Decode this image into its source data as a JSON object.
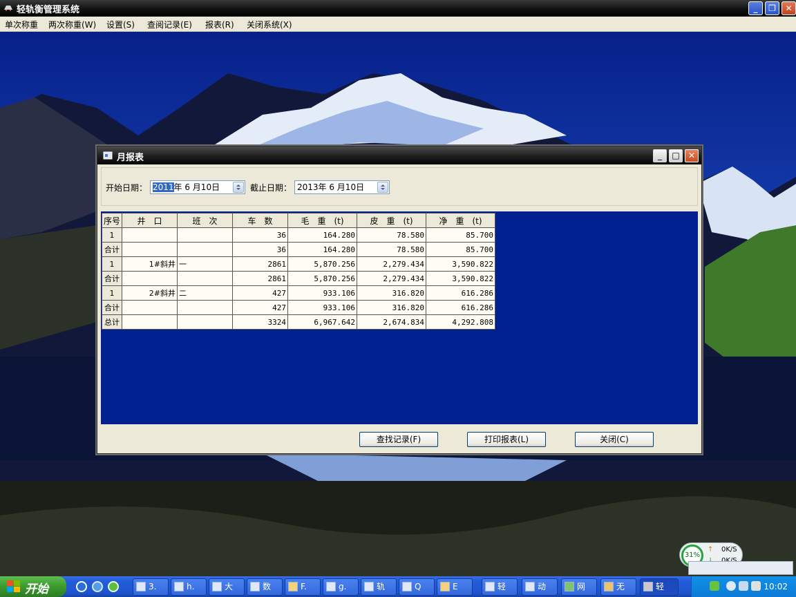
{
  "window": {
    "title": "轻轨衡管理系统",
    "minimize_glyph": "_",
    "restore_glyph": "❐",
    "close_glyph": "✕"
  },
  "menu": {
    "items": [
      {
        "label": "单次称重"
      },
      {
        "label": "两次称重(W)"
      },
      {
        "label": "设置(S)"
      },
      {
        "label": "查阅记录(E)"
      },
      {
        "label": "报表(R)"
      },
      {
        "label": "关闭系统(X)"
      }
    ]
  },
  "dialog": {
    "title": "月报表",
    "start_date_label": "开始日期：",
    "start_date_year": "2011",
    "start_date_rest": "年 6 月10日",
    "end_date_label": "截止日期：",
    "end_date_value": "2013年 6 月10日",
    "columns": [
      "序号",
      "井　口",
      "班　次",
      "车　数",
      "毛　重　(t)",
      "皮　重　(t)",
      "净　重　(t)"
    ],
    "rows": [
      [
        "1",
        "",
        "",
        "36",
        "164.280",
        "78.580",
        "85.700"
      ],
      [
        "合计",
        "",
        "",
        "36",
        "164.280",
        "78.580",
        "85.700"
      ],
      [
        "1",
        "1#斜井",
        "一",
        "2861",
        "5,870.256",
        "2,279.434",
        "3,590.822"
      ],
      [
        "合计",
        "",
        "",
        "2861",
        "5,870.256",
        "2,279.434",
        "3,590.822"
      ],
      [
        "1",
        "2#斜井",
        "二",
        "427",
        "933.106",
        "316.820",
        "616.286"
      ],
      [
        "合计",
        "",
        "",
        "427",
        "933.106",
        "316.820",
        "616.286"
      ],
      [
        "总计",
        "",
        "",
        "3324",
        "6,967.642",
        "2,674.834",
        "4,292.808"
      ]
    ],
    "buttons": {
      "find": "查找记录(F)",
      "print": "打印报表(L)",
      "close": "关闭(C)"
    }
  },
  "taskbar": {
    "start_label": "开始",
    "tasks": [
      {
        "label": "3."
      },
      {
        "label": "h."
      },
      {
        "label": "大"
      },
      {
        "label": "数"
      },
      {
        "label": "F."
      },
      {
        "label": "g."
      },
      {
        "label": "轨"
      },
      {
        "label": "Q"
      },
      {
        "label": "E"
      },
      {
        "label": "轻"
      },
      {
        "label": "动"
      },
      {
        "label": "网"
      },
      {
        "label": "无"
      },
      {
        "label": "轻",
        "active": true
      }
    ],
    "clock": "10:02"
  },
  "net_widget": {
    "percent": "31%",
    "up_rate": "0K/S",
    "down_rate": "0K/S"
  },
  "colors": {
    "grid_background": "#00218f",
    "dialog_face": "#ece9d8",
    "taskbar": "#245edb",
    "start_button": "#3a9a2f"
  }
}
